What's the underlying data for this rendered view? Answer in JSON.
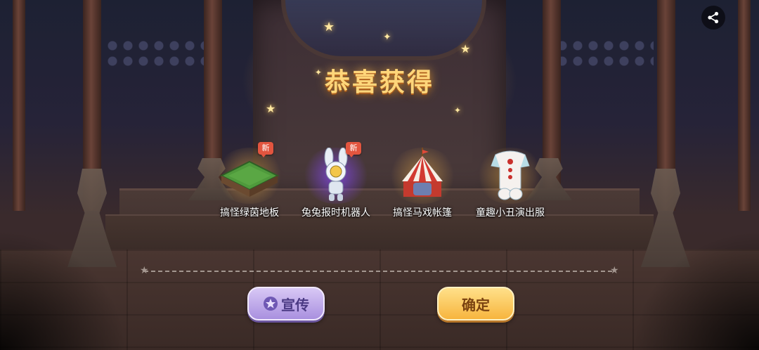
{
  "dialog": {
    "title": "恭喜获得"
  },
  "rewards": [
    {
      "name": "搞怪绿茵地板",
      "is_new": true,
      "new_badge": "新",
      "icon": "grass-floor-tile-icon",
      "glow": "#f2b24a"
    },
    {
      "name": "兔兔报时机器人",
      "is_new": true,
      "new_badge": "新",
      "icon": "rabbit-clock-robot-icon",
      "glow": "#8a4bff"
    },
    {
      "name": "搞怪马戏帐篷",
      "is_new": false,
      "icon": "circus-tent-icon",
      "glow": "#f2b24a"
    },
    {
      "name": "童趣小丑演出服",
      "is_new": false,
      "icon": "clown-costume-icon",
      "glow": "#f2b24a"
    }
  ],
  "buttons": {
    "promote_label": "宣传",
    "confirm_label": "确定"
  },
  "icons": {
    "share": "share-icon",
    "promote": "star-badge-icon"
  },
  "colors": {
    "title": "#ffd67a",
    "promote_bg": "#c3b1ee",
    "confirm_bg": "#fbc85f",
    "new_badge": "#e2553f"
  }
}
